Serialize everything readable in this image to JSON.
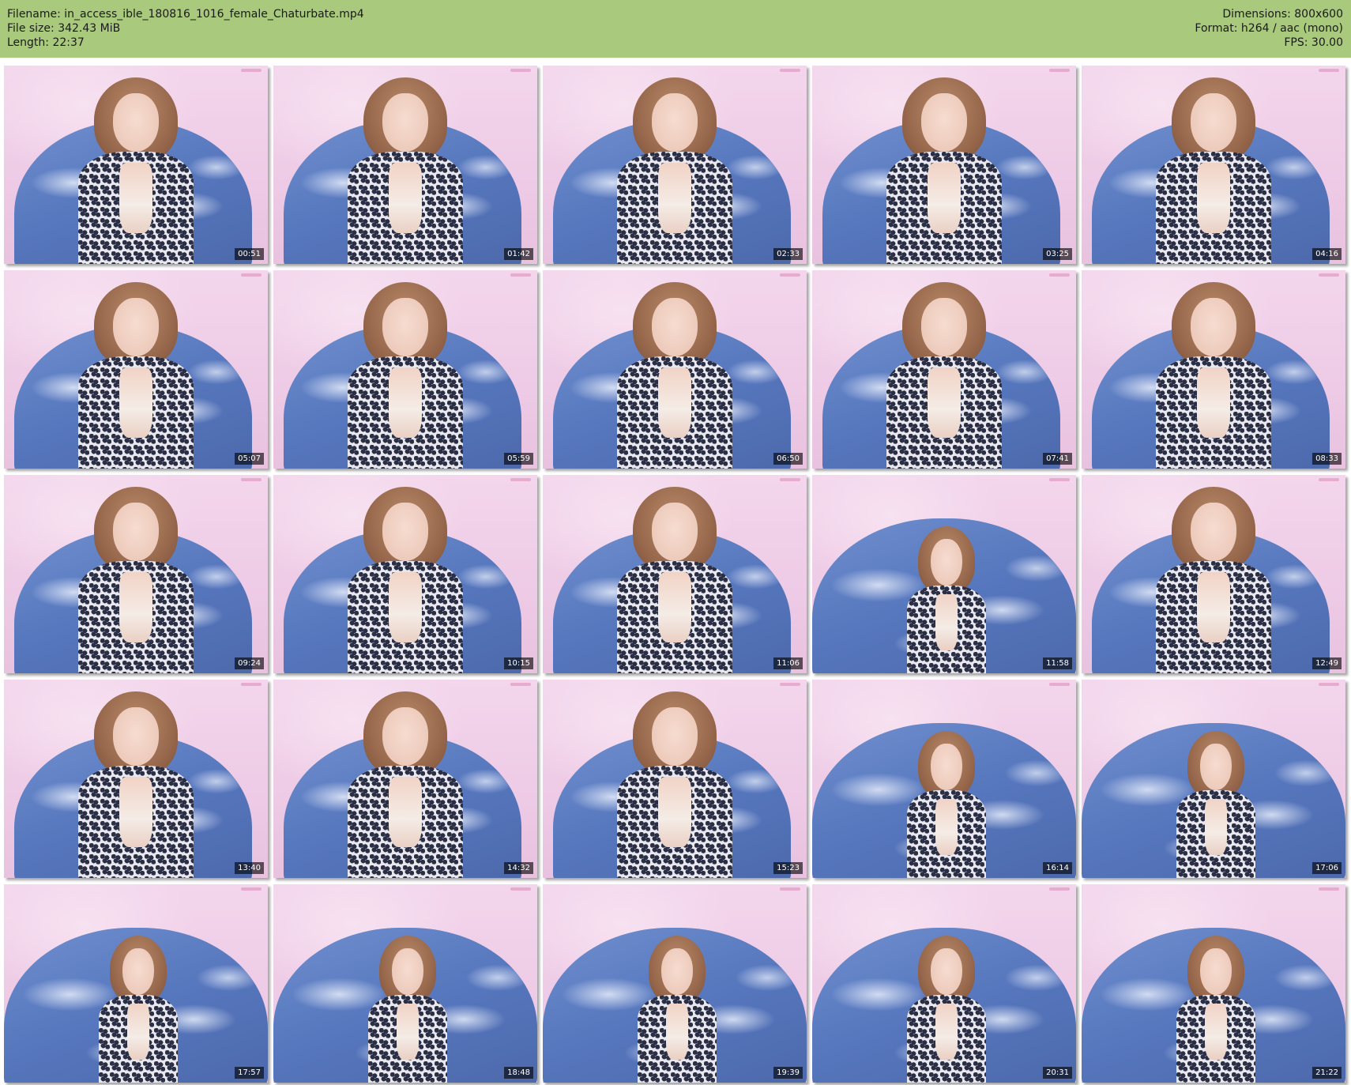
{
  "header": {
    "left": [
      "Filename: in_access_ible_180816_1016_female_Chaturbate.mp4",
      "File size: 342.43 MiB",
      "Length: 22:37"
    ],
    "right": [
      "Dimensions: 800x600",
      "Format: h264 / aac (mono)",
      "FPS: 30.00"
    ],
    "background_color": "#a9c97c"
  },
  "thumbnails": [
    {
      "time": "00:51",
      "view": "close"
    },
    {
      "time": "01:42",
      "view": "close"
    },
    {
      "time": "02:33",
      "view": "close"
    },
    {
      "time": "03:25",
      "view": "close"
    },
    {
      "time": "04:16",
      "view": "close"
    },
    {
      "time": "05:07",
      "view": "close"
    },
    {
      "time": "05:59",
      "view": "close"
    },
    {
      "time": "06:50",
      "view": "close"
    },
    {
      "time": "07:41",
      "view": "close"
    },
    {
      "time": "08:33",
      "view": "close"
    },
    {
      "time": "09:24",
      "view": "close"
    },
    {
      "time": "10:15",
      "view": "close"
    },
    {
      "time": "11:06",
      "view": "close"
    },
    {
      "time": "11:58",
      "view": "wide"
    },
    {
      "time": "12:49",
      "view": "close"
    },
    {
      "time": "13:40",
      "view": "close"
    },
    {
      "time": "14:32",
      "view": "close"
    },
    {
      "time": "15:23",
      "view": "close"
    },
    {
      "time": "16:14",
      "view": "wide"
    },
    {
      "time": "17:06",
      "view": "wide"
    },
    {
      "time": "17:57",
      "view": "wide"
    },
    {
      "time": "18:48",
      "view": "wide"
    },
    {
      "time": "19:39",
      "view": "wide"
    },
    {
      "time": "20:31",
      "view": "wide"
    },
    {
      "time": "21:22",
      "view": "wide"
    }
  ]
}
